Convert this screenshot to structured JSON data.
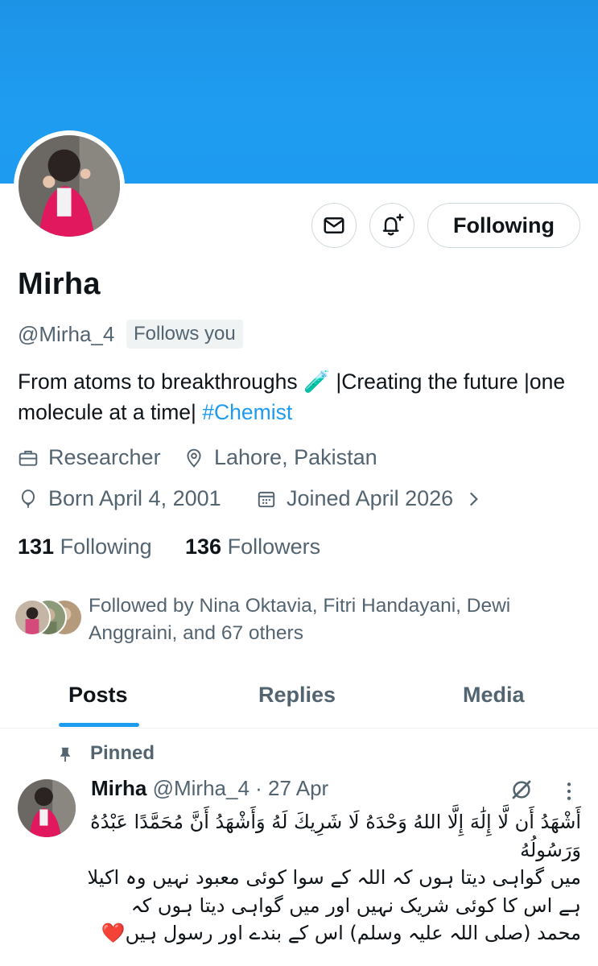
{
  "colors": {
    "accent": "#1d9bf0",
    "banner": "#1d9bf0",
    "text": "#0f1419",
    "secondary": "#536471",
    "border": "#cfd9de",
    "heart": "#e0245e"
  },
  "profile": {
    "name": "Mirha",
    "handle": "@Mirha_4",
    "follows_you": "Follows you",
    "bio_text": "From atoms to breakthroughs 🧪 |Creating the future |one molecule at a time| ",
    "bio_hashtag": "#Chemist",
    "profession": "Researcher",
    "location": "Lahore, Pakistan",
    "born": "Born April 4, 2001",
    "joined": "Joined April 2026",
    "following_count": "131",
    "following_label": "Following",
    "followers_count": "136",
    "followers_label": "Followers",
    "followed_by": "Followed by Nina Oktavia, Fitri Handayani, Dewi Anggraini, and 67 others"
  },
  "actions": {
    "message_icon": "envelope-icon",
    "notify_icon": "bell-plus-icon",
    "follow_label": "Following"
  },
  "tabs": [
    {
      "label": "Posts",
      "active": true
    },
    {
      "label": "Replies",
      "active": false
    },
    {
      "label": "Media",
      "active": false
    }
  ],
  "pinned_tweet": {
    "pinned_label": "Pinned",
    "author": "Mirha",
    "handle": "@Mirha_4",
    "separator": "·",
    "date": "27 Apr",
    "lines": [
      "أَشْهَدُ أَن لَّا إِلَٰهَ إِلَّا اللهُ وَحْدَهُ لَا شَرِيكَ لَهُ وَأَشْهَدُ أَنَّ مُحَمَّدًا عَبْدُهُ",
      "وَرَسُولُهُ",
      "میں گواہی دیتا ہوں کہ اللہ کے سوا کوئی معبود نہیں وہ اکیلا",
      "ہے اس کا کوئی شریک نہیں اور میں گواہی دیتا ہوں کہ",
      "محمد (صلی اللہ علیہ وسلم) اس کے بندے اور رسول ہیں❤️"
    ]
  }
}
